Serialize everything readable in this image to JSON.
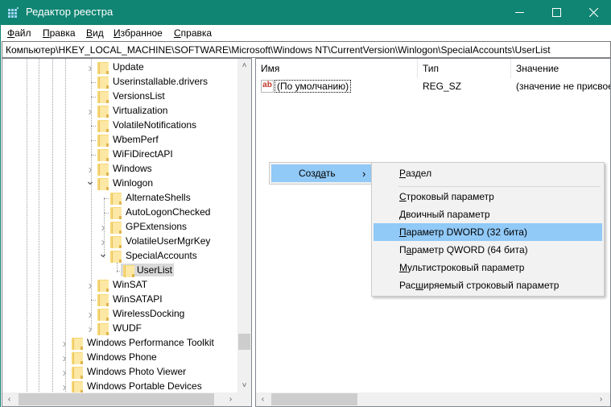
{
  "window": {
    "title": "Редактор реестра",
    "accent_color": "#108573",
    "controls": {
      "minimize": "—",
      "maximize": "☐",
      "close": "✕"
    }
  },
  "menu": [
    {
      "label": "Файл",
      "accel": "Ф",
      "rest": "айл"
    },
    {
      "label": "Правка",
      "accel": "П",
      "rest": "равка"
    },
    {
      "label": "Вид",
      "accel": "В",
      "rest": "ид"
    },
    {
      "label": "Избранное",
      "accel": "И",
      "rest": "збранное"
    },
    {
      "label": "Справка",
      "accel": "С",
      "rest": "правка"
    }
  ],
  "address": "Компьютер\\HKEY_LOCAL_MACHINE\\SOFTWARE\\Microsoft\\Windows NT\\CurrentVersion\\Winlogon\\SpecialAccounts\\UserList",
  "tree": {
    "items": [
      {
        "label": "Update",
        "level": 2,
        "expander": "collapsed"
      },
      {
        "label": "Userinstallable.drivers",
        "level": 2,
        "expander": "none"
      },
      {
        "label": "VersionsList",
        "level": 2,
        "expander": "none"
      },
      {
        "label": "Virtualization",
        "level": 2,
        "expander": "collapsed"
      },
      {
        "label": "VolatileNotifications",
        "level": 2,
        "expander": "none"
      },
      {
        "label": "WbemPerf",
        "level": 2,
        "expander": "none"
      },
      {
        "label": "WiFiDirectAPI",
        "level": 2,
        "expander": "none"
      },
      {
        "label": "Windows",
        "level": 2,
        "expander": "collapsed"
      },
      {
        "label": "Winlogon",
        "level": 2,
        "expander": "expanded"
      },
      {
        "label": "AlternateShells",
        "level": 3,
        "expander": "none"
      },
      {
        "label": "AutoLogonChecked",
        "level": 3,
        "expander": "none"
      },
      {
        "label": "GPExtensions",
        "level": 3,
        "expander": "collapsed"
      },
      {
        "label": "VolatileUserMgrKey",
        "level": 3,
        "expander": "collapsed"
      },
      {
        "label": "SpecialAccounts",
        "level": 3,
        "expander": "expanded"
      },
      {
        "label": "UserList",
        "level": 4,
        "expander": "none",
        "selected": true
      },
      {
        "label": "WinSAT",
        "level": 2,
        "expander": "collapsed"
      },
      {
        "label": "WinSATAPI",
        "level": 2,
        "expander": "none"
      },
      {
        "label": "WirelessDocking",
        "level": 2,
        "expander": "collapsed"
      },
      {
        "label": "WUDF",
        "level": 2,
        "expander": "collapsed"
      },
      {
        "label": "Windows Performance Toolkit",
        "level": 1,
        "expander": "collapsed"
      },
      {
        "label": "Windows Phone",
        "level": 1,
        "expander": "collapsed"
      },
      {
        "label": "Windows Photo Viewer",
        "level": 1,
        "expander": "collapsed"
      },
      {
        "label": "Windows Portable Devices",
        "level": 1,
        "expander": "collapsed"
      }
    ]
  },
  "list": {
    "columns": [
      "Имя",
      "Тип",
      "Значение"
    ],
    "rows": [
      {
        "icon": "string-value-icon",
        "icon_text": "ab",
        "name": "(По умолчанию)",
        "type": "REG_SZ",
        "value": "(значение не присвое"
      }
    ]
  },
  "context_menu": {
    "main": {
      "label": "Создать",
      "accel": "а",
      "arrow": "›"
    },
    "submenu": [
      {
        "pre": "",
        "accel": "Р",
        "post": "аздел",
        "full": "Раздел"
      },
      {
        "separator": true
      },
      {
        "pre": "",
        "accel": "С",
        "post": "троковый параметр",
        "full": "Строковый параметр"
      },
      {
        "pre": "",
        "accel": "Д",
        "post": "воичный параметр",
        "full": "Двоичный параметр"
      },
      {
        "pre": "",
        "accel": "П",
        "post": "араметр DWORD (32 бита)",
        "full": "Параметр DWORD (32 бита)",
        "highlighted": true
      },
      {
        "pre": "П",
        "accel": "а",
        "post": "раметр QWORD (64 бита)",
        "full": "Параметр QWORD (64 бита)"
      },
      {
        "pre": "",
        "accel": "М",
        "post": "ультистроковый параметр",
        "full": "Мультистроковый параметр"
      },
      {
        "pre": "Рас",
        "accel": "ш",
        "post": "иряемый строковый параметр",
        "full": "Расширяемый строковый параметр"
      }
    ],
    "highlight_color": "#91c9f7"
  },
  "scroll": {
    "up": "˄",
    "down": "˅",
    "left": "‹",
    "right": "›"
  }
}
